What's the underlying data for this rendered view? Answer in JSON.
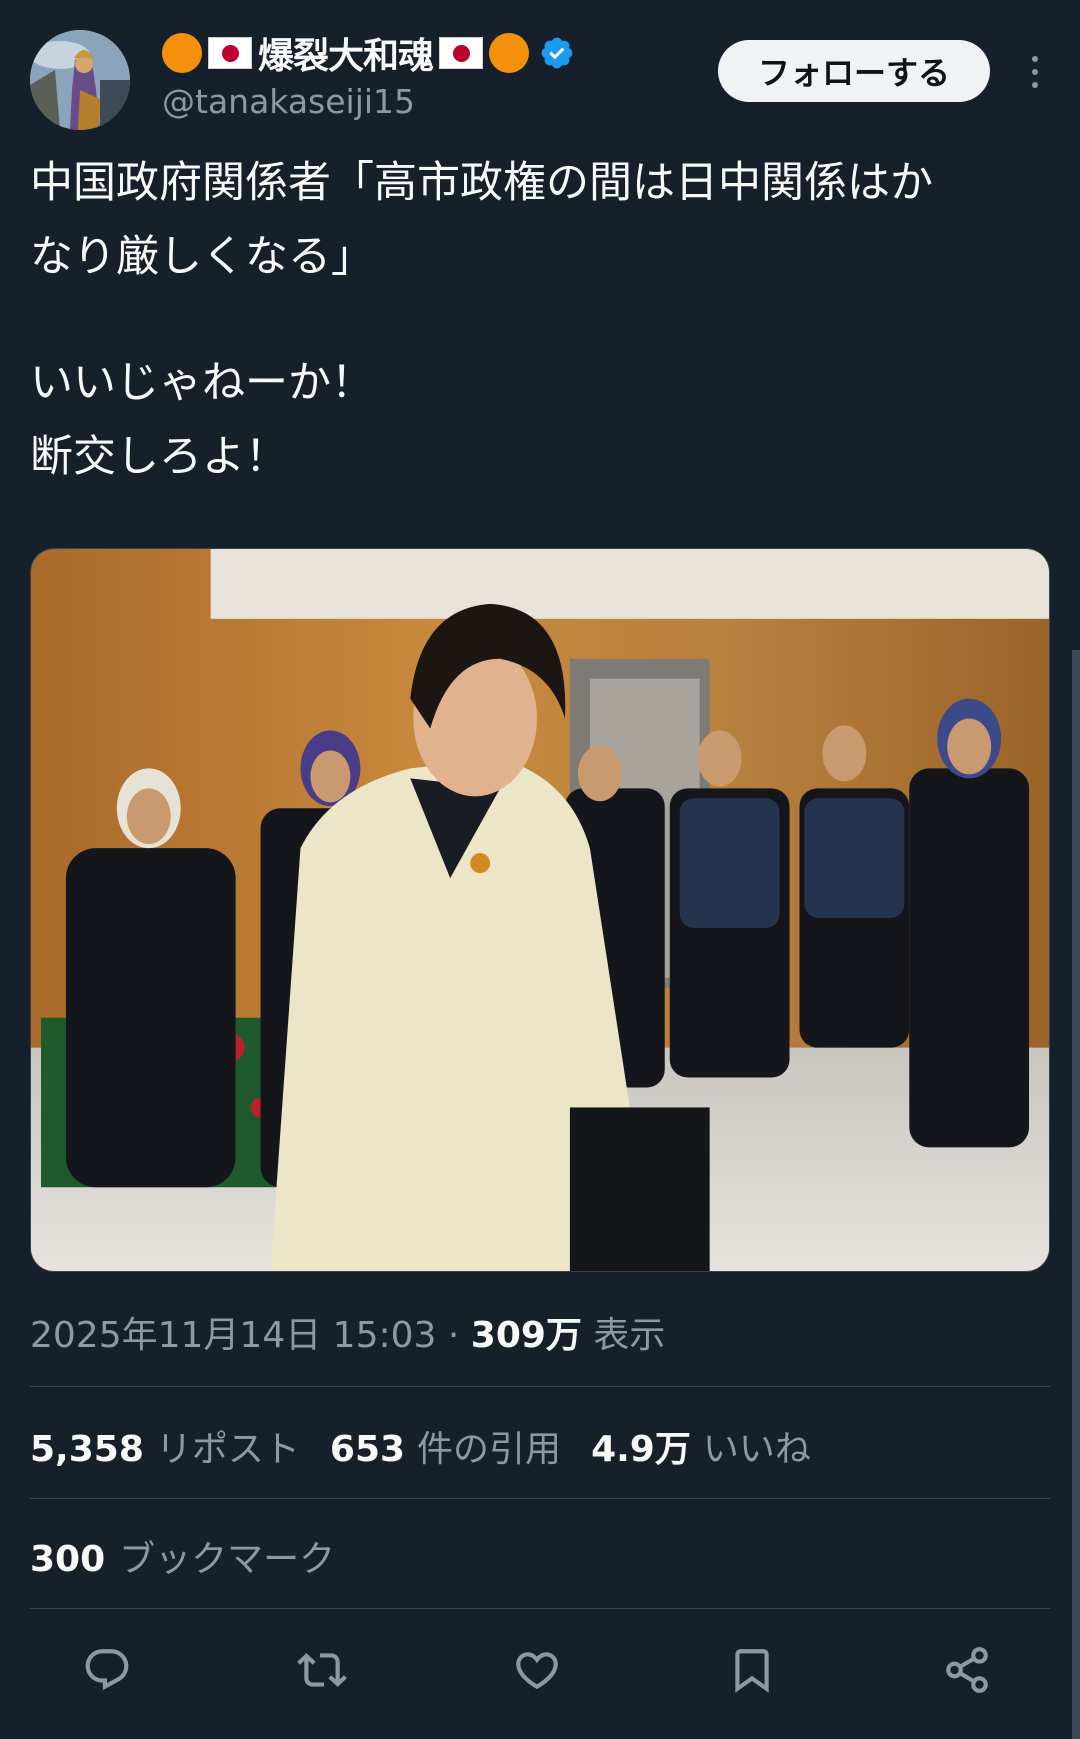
{
  "user": {
    "display_name": "爆裂大和魂",
    "handle": "@tanakaseiji15",
    "verified": true,
    "name_decorations": [
      "orange-circle",
      "japan-flag",
      "japan-flag",
      "orange-circle"
    ]
  },
  "follow_button": {
    "label": "フォローする"
  },
  "tweet": {
    "lines": [
      "中国政府関係者「高市政権の間は日中関係はか",
      "なり厳しくなる」",
      "いいじゃねーか！",
      "断交しろよ！"
    ]
  },
  "meta": {
    "timestamp": "2025年11月14日 15:03",
    "separator": " · ",
    "views_count": "309万",
    "views_label": " 表示"
  },
  "stats": {
    "reposts": {
      "count": "5,358",
      "label": "リポスト"
    },
    "quotes": {
      "count": "653",
      "label": "件の引用"
    },
    "likes": {
      "count": "4.9万",
      "label": "いいね"
    },
    "bookmarks": {
      "count": "300",
      "label": "ブックマーク"
    }
  },
  "actions": [
    "reply-icon",
    "repost-icon",
    "like-icon",
    "bookmark-icon",
    "share-icon"
  ],
  "colors": {
    "background": "#15202b",
    "text": "#f7f9f9",
    "secondary_text": "#8b98a5",
    "divider": "#38444d",
    "verified_blue": "#1d9bf0",
    "follow_button_bg": "#eff3f4"
  }
}
